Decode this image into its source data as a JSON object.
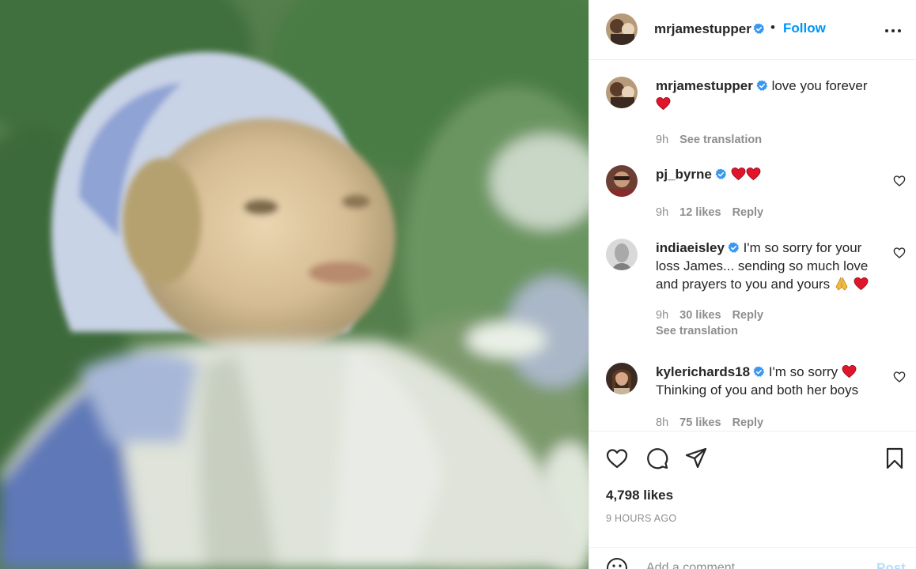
{
  "post": {
    "author": "mrjamestupper",
    "follow_label": "Follow",
    "dot": "•",
    "likes": "4,798 likes",
    "time_ago": "9 HOURS AGO"
  },
  "comments": [
    {
      "user": "mrjamestupper",
      "text": "love you forever",
      "time": "9h",
      "likes": "",
      "reply": "",
      "see_translation": "See translation"
    },
    {
      "user": "pj_byrne",
      "text": "",
      "time": "9h",
      "likes": "12 likes",
      "reply": "Reply"
    },
    {
      "user": "indiaeisley",
      "text": "I'm so sorry for your loss James... sending so much love and prayers to you and yours",
      "time": "9h",
      "likes": "30 likes",
      "reply": "Reply",
      "see_translation": "See translation"
    },
    {
      "user": "kylerichards18",
      "text_a": "I'm so sorry",
      "text_b": "Thinking of you and both her boys",
      "time": "8h",
      "likes": "75 likes",
      "reply": "Reply"
    }
  ],
  "add_comment": {
    "placeholder": "Add a comment…",
    "post_label": "Post"
  },
  "icons": {
    "verified": "verified-badge-icon",
    "more": "more-options-icon",
    "like": "heart-icon",
    "comment": "comment-bubble-icon",
    "share": "paper-plane-icon",
    "save": "bookmark-icon",
    "emoji": "smiley-icon"
  },
  "colors": {
    "accent": "#0095f6",
    "verified": "#3897f0",
    "muted": "#8e8e8e",
    "heart_emoji": "#e0142a",
    "post_disabled": "#b2dffc"
  }
}
